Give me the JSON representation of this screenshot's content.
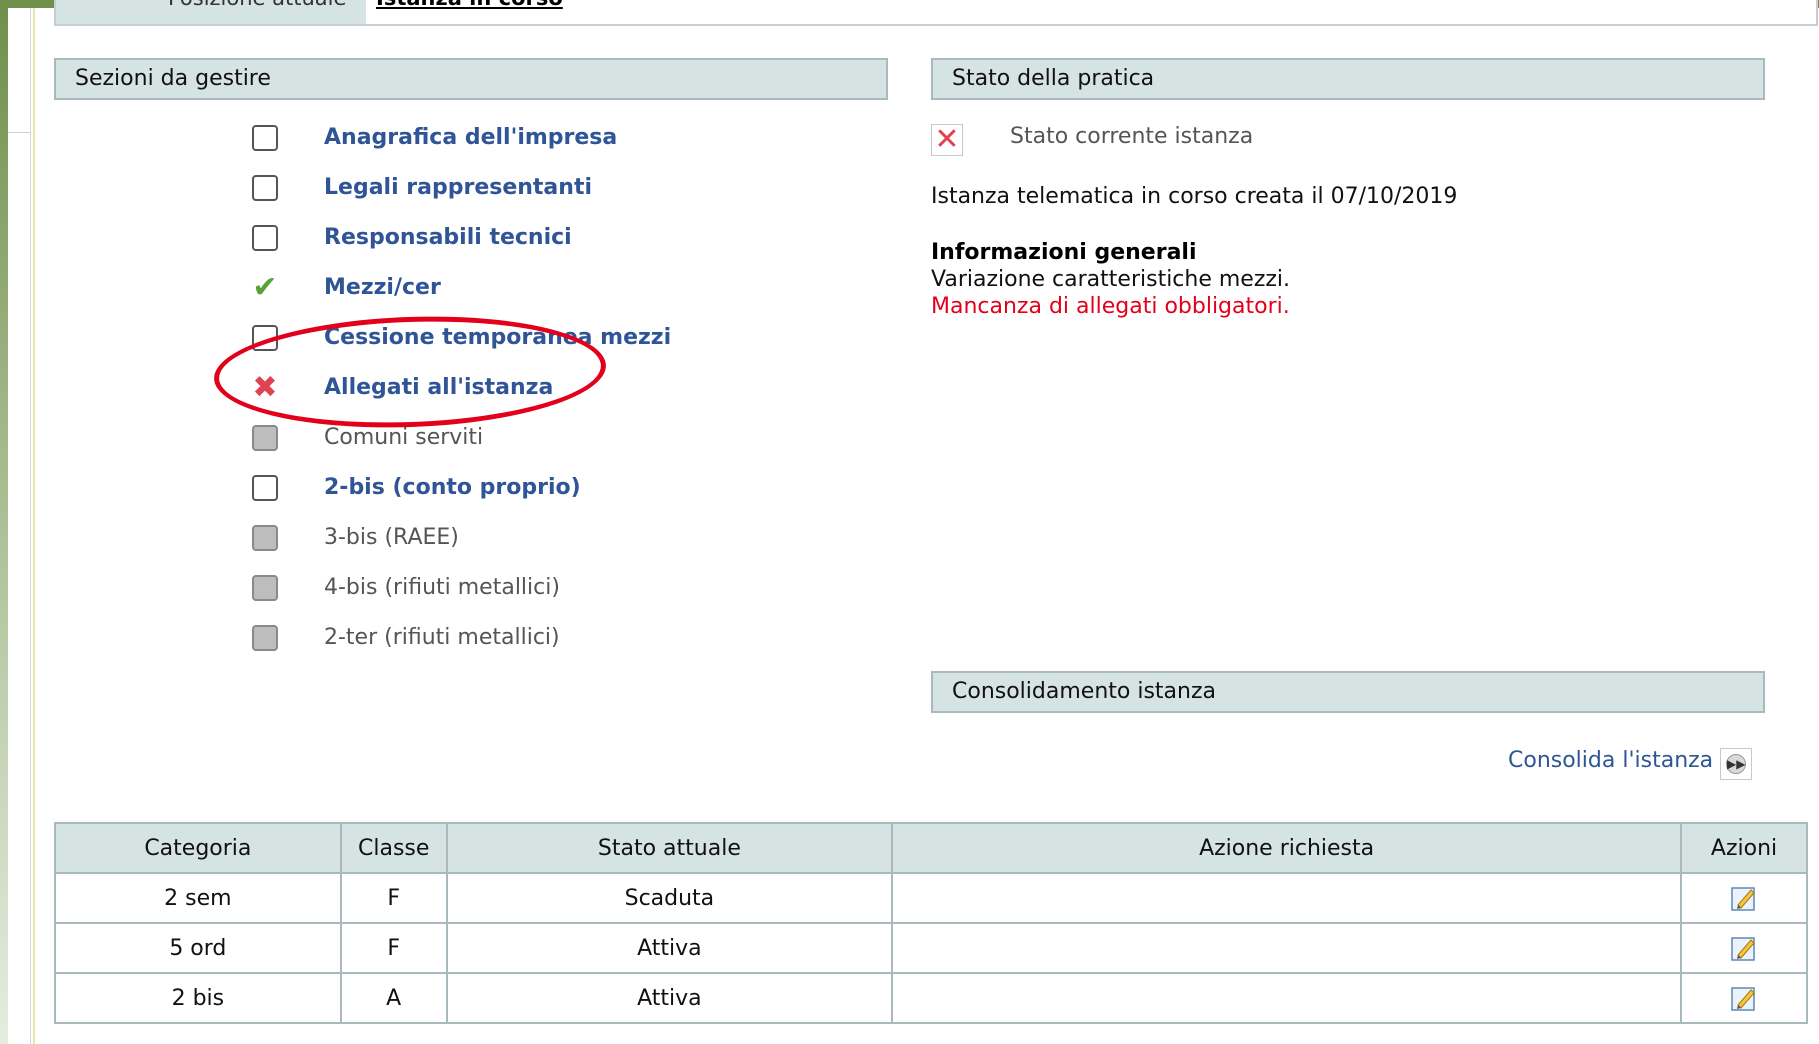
{
  "position_bar": {
    "label": "Posizione attuale",
    "value": "Istanza in corso"
  },
  "sections": {
    "header": "Sezioni da gestire",
    "items": [
      {
        "label": "Anagrafica dell'impresa",
        "status": "empty",
        "style": "link"
      },
      {
        "label": "Legali rappresentanti",
        "status": "empty",
        "style": "link"
      },
      {
        "label": "Responsabili tecnici",
        "status": "empty",
        "style": "link"
      },
      {
        "label": "Mezzi/cer",
        "status": "ok",
        "style": "link"
      },
      {
        "label": "Cessione temporanea mezzi",
        "status": "empty",
        "style": "link"
      },
      {
        "label": "Allegati all'istanza",
        "status": "error",
        "style": "link"
      },
      {
        "label": "Comuni serviti",
        "status": "disabled",
        "style": "disabled"
      },
      {
        "label": "2-bis (conto proprio)",
        "status": "empty",
        "style": "link"
      },
      {
        "label": "3-bis (RAEE)",
        "status": "disabled",
        "style": "disabled"
      },
      {
        "label": "4-bis (rifiuti metallici)",
        "status": "disabled",
        "style": "disabled"
      },
      {
        "label": "2-ter (rifiuti metallici)",
        "status": "disabled",
        "style": "disabled"
      }
    ]
  },
  "stato": {
    "header": "Stato della pratica",
    "current_label": "Stato corrente istanza",
    "current_icon": "error-x-icon",
    "created_text": "Istanza telematica in corso creata il 07/10/2019",
    "info_title": "Informazioni generali",
    "info_text": "Variazione caratteristiche mezzi.",
    "warning_text": "Mancanza di allegati obbligatori."
  },
  "consolidamento": {
    "header": "Consolidamento istanza",
    "action_label": "Consolida l'istanza",
    "action_icon": "forward-icon"
  },
  "table": {
    "headers": [
      "Categoria",
      "Classe",
      "Stato attuale",
      "Azione richiesta",
      "Azioni"
    ],
    "rows": [
      {
        "categoria": "2 sem",
        "classe": "F",
        "stato": "Scaduta",
        "azione": ""
      },
      {
        "categoria": "5 ord",
        "classe": "F",
        "stato": "Attiva",
        "azione": ""
      },
      {
        "categoria": "2 bis",
        "classe": "A",
        "stato": "Attiva",
        "azione": ""
      }
    ]
  },
  "colors": {
    "header_bg": "#d6e3e3",
    "link": "#2f5597",
    "error": "#e3001b",
    "ok": "#57a33a",
    "frame": "#6f8f4a"
  }
}
